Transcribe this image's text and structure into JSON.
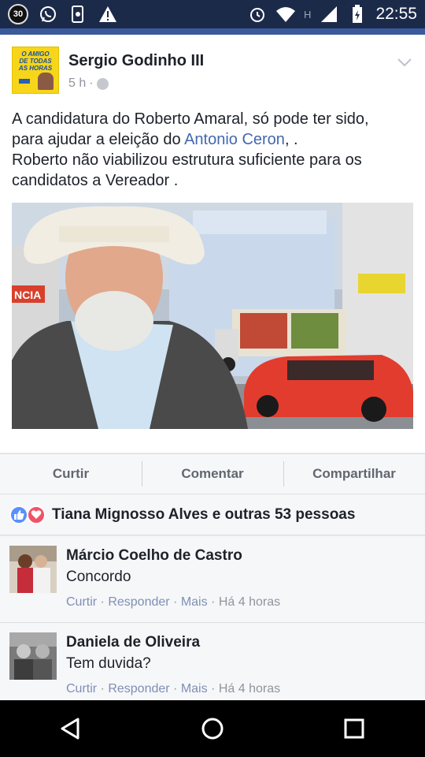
{
  "status_bar": {
    "notification_count": "30",
    "network_label": "H",
    "time": "22:55",
    "icons": [
      "whatsapp-icon",
      "phone-settings-icon",
      "warning-icon",
      "alarm-icon",
      "wifi-icon",
      "signal-icon",
      "battery-icon"
    ]
  },
  "post": {
    "author": "Sergio Godinho III",
    "time": "5 h",
    "separator": "·",
    "page_avatar_text": [
      "O AMIGO",
      "DE TODAS",
      "AS HORAS"
    ],
    "text_line1": "A candidatura do Roberto Amaral, só pode ter sido,",
    "text_line2_prefix": "para ajudar a eleição do ",
    "text_line2_link": "Antonio Ceron",
    "text_line2_suffix": ", .",
    "text_line3": "Roberto não viabilizou estrutura suficiente para os",
    "text_line4": "candidatos a Vereador ."
  },
  "actions": {
    "like": "Curtir",
    "comment": "Comentar",
    "share": "Compartilhar"
  },
  "reactions": {
    "text": "Tiana Mignosso Alves e outras 53 pessoas"
  },
  "comments": [
    {
      "name": "Márcio Coelho de Castro",
      "text": "Concordo",
      "like": "Curtir",
      "reply": "Responder",
      "more": "Mais",
      "time": "Há 4 horas",
      "sep": " · "
    },
    {
      "name": "Daniela de Oliveira",
      "text": "Tem duvida?",
      "like": "Curtir",
      "reply": "Responder",
      "more": "Mais",
      "time": "Há 4 horas",
      "sep": " · "
    }
  ],
  "photo": {
    "sign_text": "NCIA"
  },
  "colors": {
    "status_bar": "#1c2a4a",
    "facebook_blue": "#4267b2",
    "like_blue": "#5890ff",
    "love_red": "#f25268"
  }
}
